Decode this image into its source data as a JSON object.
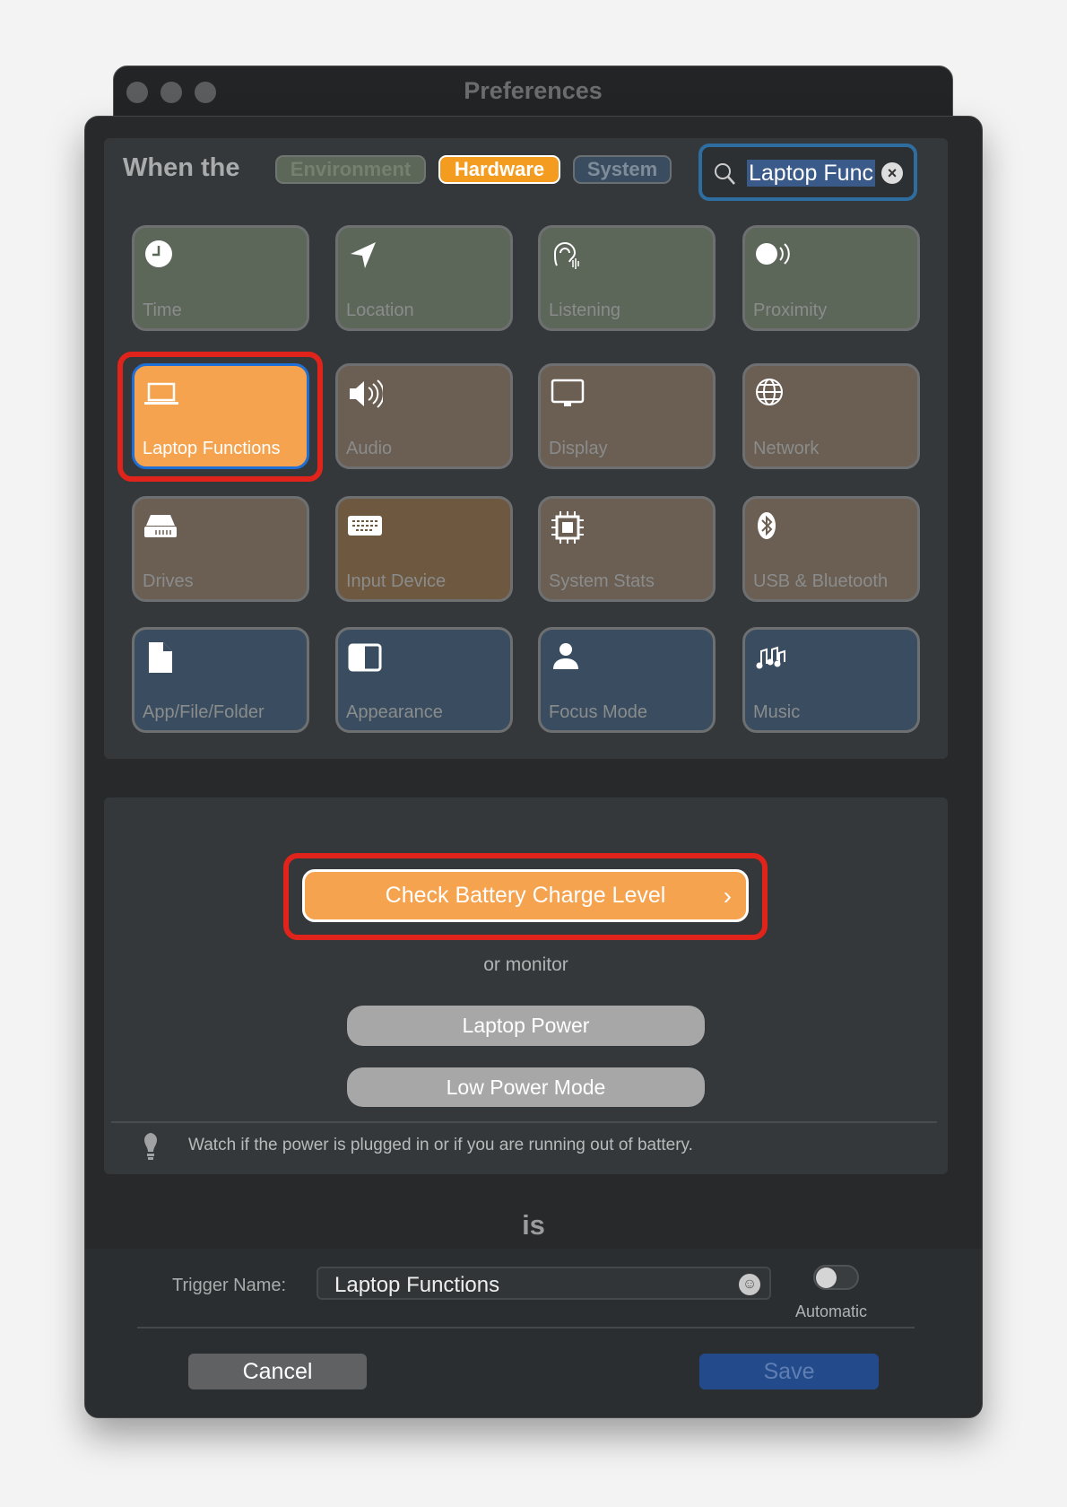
{
  "window": {
    "title": "Preferences"
  },
  "header": {
    "when_label": "When the",
    "categories": [
      {
        "label": "Environment",
        "color": "#5c6659"
      },
      {
        "label": "Hardware",
        "color": "#f39c1f",
        "selected": true
      },
      {
        "label": "System",
        "color": "#3a4d60"
      }
    ],
    "search": {
      "value": "Laptop Func"
    }
  },
  "tiles": [
    {
      "label": "Time",
      "icon": "clock-icon"
    },
    {
      "label": "Location",
      "icon": "location-arrow-icon"
    },
    {
      "label": "Listening",
      "icon": "ear-icon"
    },
    {
      "label": "Proximity",
      "icon": "proximity-icon"
    },
    {
      "label": "Laptop Functions",
      "icon": "laptop-icon",
      "selected": true
    },
    {
      "label": "Audio",
      "icon": "speaker-icon"
    },
    {
      "label": "Display",
      "icon": "display-icon"
    },
    {
      "label": "Network",
      "icon": "globe-icon"
    },
    {
      "label": "Drives",
      "icon": "drive-icon"
    },
    {
      "label": "Input Device",
      "icon": "keyboard-icon"
    },
    {
      "label": "System Stats",
      "icon": "cpu-icon"
    },
    {
      "label": "USB & Bluetooth",
      "icon": "bluetooth-icon"
    },
    {
      "label": "App/File/Folder",
      "icon": "file-icon"
    },
    {
      "label": "Appearance",
      "icon": "appearance-icon"
    },
    {
      "label": "Focus Mode",
      "icon": "person-icon"
    },
    {
      "label": "Music",
      "icon": "music-icon"
    }
  ],
  "options": {
    "primary": "Check Battery Charge Level",
    "or_label": "or monitor",
    "secondary": [
      "Laptop Power",
      "Low Power Mode"
    ],
    "hint": "Watch if the power is plugged in or if you are running out of battery."
  },
  "is_label": "is",
  "footer": {
    "trigger_label": "Trigger Name:",
    "trigger_value": "Laptop Functions",
    "automatic_label": "Automatic",
    "automatic_on": false,
    "cancel": "Cancel",
    "save": "Save"
  },
  "colors": {
    "accent": "#f5a34e",
    "highlight": "#e0241b",
    "save": "#234a8a"
  }
}
